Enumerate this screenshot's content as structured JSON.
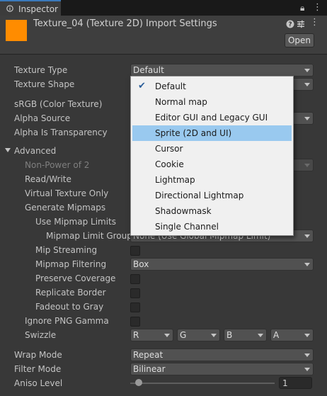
{
  "window": {
    "tab_title": "Inspector"
  },
  "header": {
    "title": "Texture_04 (Texture 2D) Import Settings",
    "open_label": "Open",
    "thumbnail_color": "#ff8c00"
  },
  "fields": {
    "texture_type": {
      "label": "Texture Type",
      "value": "Default"
    },
    "texture_shape": {
      "label": "Texture Shape"
    },
    "srgb": {
      "label": "sRGB (Color Texture)"
    },
    "alpha_source": {
      "label": "Alpha Source"
    },
    "alpha_is_transparency": {
      "label": "Alpha Is Transparency"
    },
    "advanced": {
      "label": "Advanced"
    },
    "non_power_of_2": {
      "label": "Non-Power of 2"
    },
    "read_write": {
      "label": "Read/Write"
    },
    "virtual_texture_only": {
      "label": "Virtual Texture Only"
    },
    "generate_mipmaps": {
      "label": "Generate Mipmaps"
    },
    "use_mipmap_limits": {
      "label": "Use Mipmap Limits"
    },
    "mipmap_limit_group": {
      "label": "Mipmap Limit Group",
      "value": "None (Use Global Mipmap Limit)"
    },
    "mip_streaming": {
      "label": "Mip Streaming"
    },
    "mipmap_filtering": {
      "label": "Mipmap Filtering",
      "value": "Box"
    },
    "preserve_coverage": {
      "label": "Preserve Coverage"
    },
    "replicate_border": {
      "label": "Replicate Border"
    },
    "fadeout_to_gray": {
      "label": "Fadeout to Gray"
    },
    "ignore_png_gamma": {
      "label": "Ignore PNG Gamma"
    },
    "swizzle": {
      "label": "Swizzle",
      "r": "R",
      "g": "G",
      "b": "B",
      "a": "A"
    },
    "wrap_mode": {
      "label": "Wrap Mode",
      "value": "Repeat"
    },
    "filter_mode": {
      "label": "Filter Mode",
      "value": "Bilinear"
    },
    "aniso_level": {
      "label": "Aniso Level",
      "value": "1",
      "slider_fraction": 0.06
    }
  },
  "texture_type_popup": {
    "selected": "Default",
    "highlighted": "Sprite (2D and UI)",
    "options": [
      "Default",
      "Normal map",
      "Editor GUI and Legacy GUI",
      "Sprite (2D and UI)",
      "Cursor",
      "Cookie",
      "Lightmap",
      "Directional Lightmap",
      "Shadowmask",
      "Single Channel"
    ]
  }
}
